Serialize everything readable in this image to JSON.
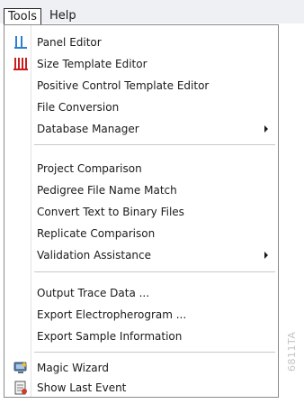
{
  "menubar": {
    "tools": "Tools",
    "help": "Help"
  },
  "tools_menu": {
    "items": [
      {
        "label": "Panel Editor",
        "icon": "panel-editor-icon"
      },
      {
        "label": "Size Template Editor",
        "icon": "size-template-icon"
      },
      {
        "label": "Positive Control Template Editor"
      },
      {
        "label": "File Conversion"
      },
      {
        "label": "Database Manager",
        "has_submenu": true
      },
      {
        "label": "Project Comparison"
      },
      {
        "label": "Pedigree File Name Match"
      },
      {
        "label": "Convert Text to Binary Files"
      },
      {
        "label": "Replicate Comparison"
      },
      {
        "label": "Validation Assistance",
        "has_submenu": true
      },
      {
        "label": "Output Trace Data ..."
      },
      {
        "label": "Export Electropherogram ..."
      },
      {
        "label": "Export Sample Information"
      },
      {
        "label": "Magic Wizard",
        "icon": "magic-wizard-icon"
      },
      {
        "label": "Show Last Event",
        "icon": "show-last-event-icon"
      }
    ]
  },
  "figure_id": "6811TA",
  "colors": {
    "panel_icon": "#2a7fd4",
    "size_template_icon": "#c81e1e",
    "menubar_bg": "#eef0f4",
    "separator": "#c8c8c8"
  }
}
